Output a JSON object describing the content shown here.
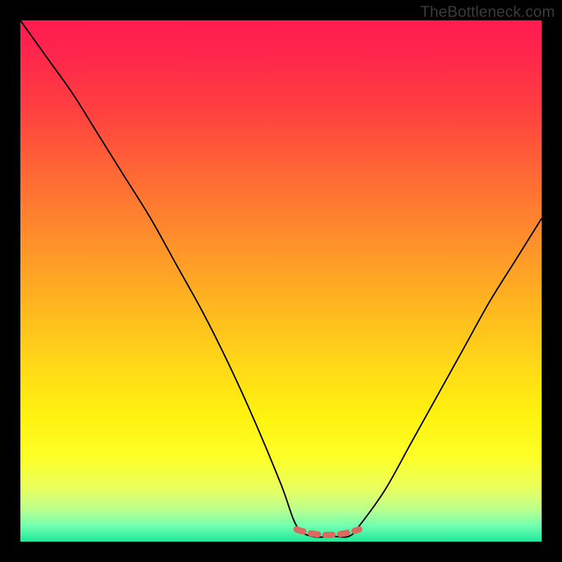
{
  "watermark": "TheBottleneck.com",
  "colors": {
    "frame": "#000000",
    "curve": "#000000",
    "dash": "#d86a5f",
    "gradient_top": "#ff1a4f",
    "gradient_bottom": "#20e89a"
  },
  "chart_data": {
    "type": "line",
    "title": "",
    "xlabel": "",
    "ylabel": "",
    "xlim": [
      0,
      100
    ],
    "ylim": [
      0,
      100
    ],
    "series": [
      {
        "name": "bottleneck-curve",
        "x": [
          0,
          5,
          10,
          15,
          20,
          25,
          30,
          35,
          40,
          45,
          50,
          53,
          56,
          60,
          63,
          65,
          70,
          75,
          80,
          85,
          90,
          95,
          100
        ],
        "y": [
          100,
          93,
          86,
          78,
          70,
          62,
          53,
          44,
          34,
          23,
          11,
          3,
          1,
          1,
          1,
          3,
          10,
          19,
          28,
          37,
          46,
          54,
          62
        ]
      }
    ],
    "annotations": [
      {
        "name": "optimal-range-marker",
        "x_start": 53,
        "x_end": 65,
        "y": 1,
        "style": "dashed",
        "color": "#d86a5f"
      }
    ]
  }
}
